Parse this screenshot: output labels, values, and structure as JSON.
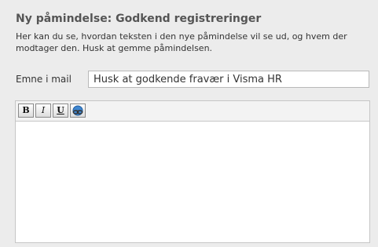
{
  "header": {
    "title": "Ny påmindelse: Godkend registreringer",
    "description": "Her kan du se, hvordan teksten i den nye påmindelse vil se ud, og hvem der modtager den. Husk at gemme påmindelsen."
  },
  "subject": {
    "label": "Emne i mail",
    "value": "Husk at godkende fravær i Visma HR"
  },
  "toolbar": {
    "bold_label": "B",
    "italic_label": "I",
    "underline_label": "U",
    "link_icon": "link-icon",
    "icon_color": "#2a6fb8"
  },
  "editor": {
    "content": ""
  }
}
